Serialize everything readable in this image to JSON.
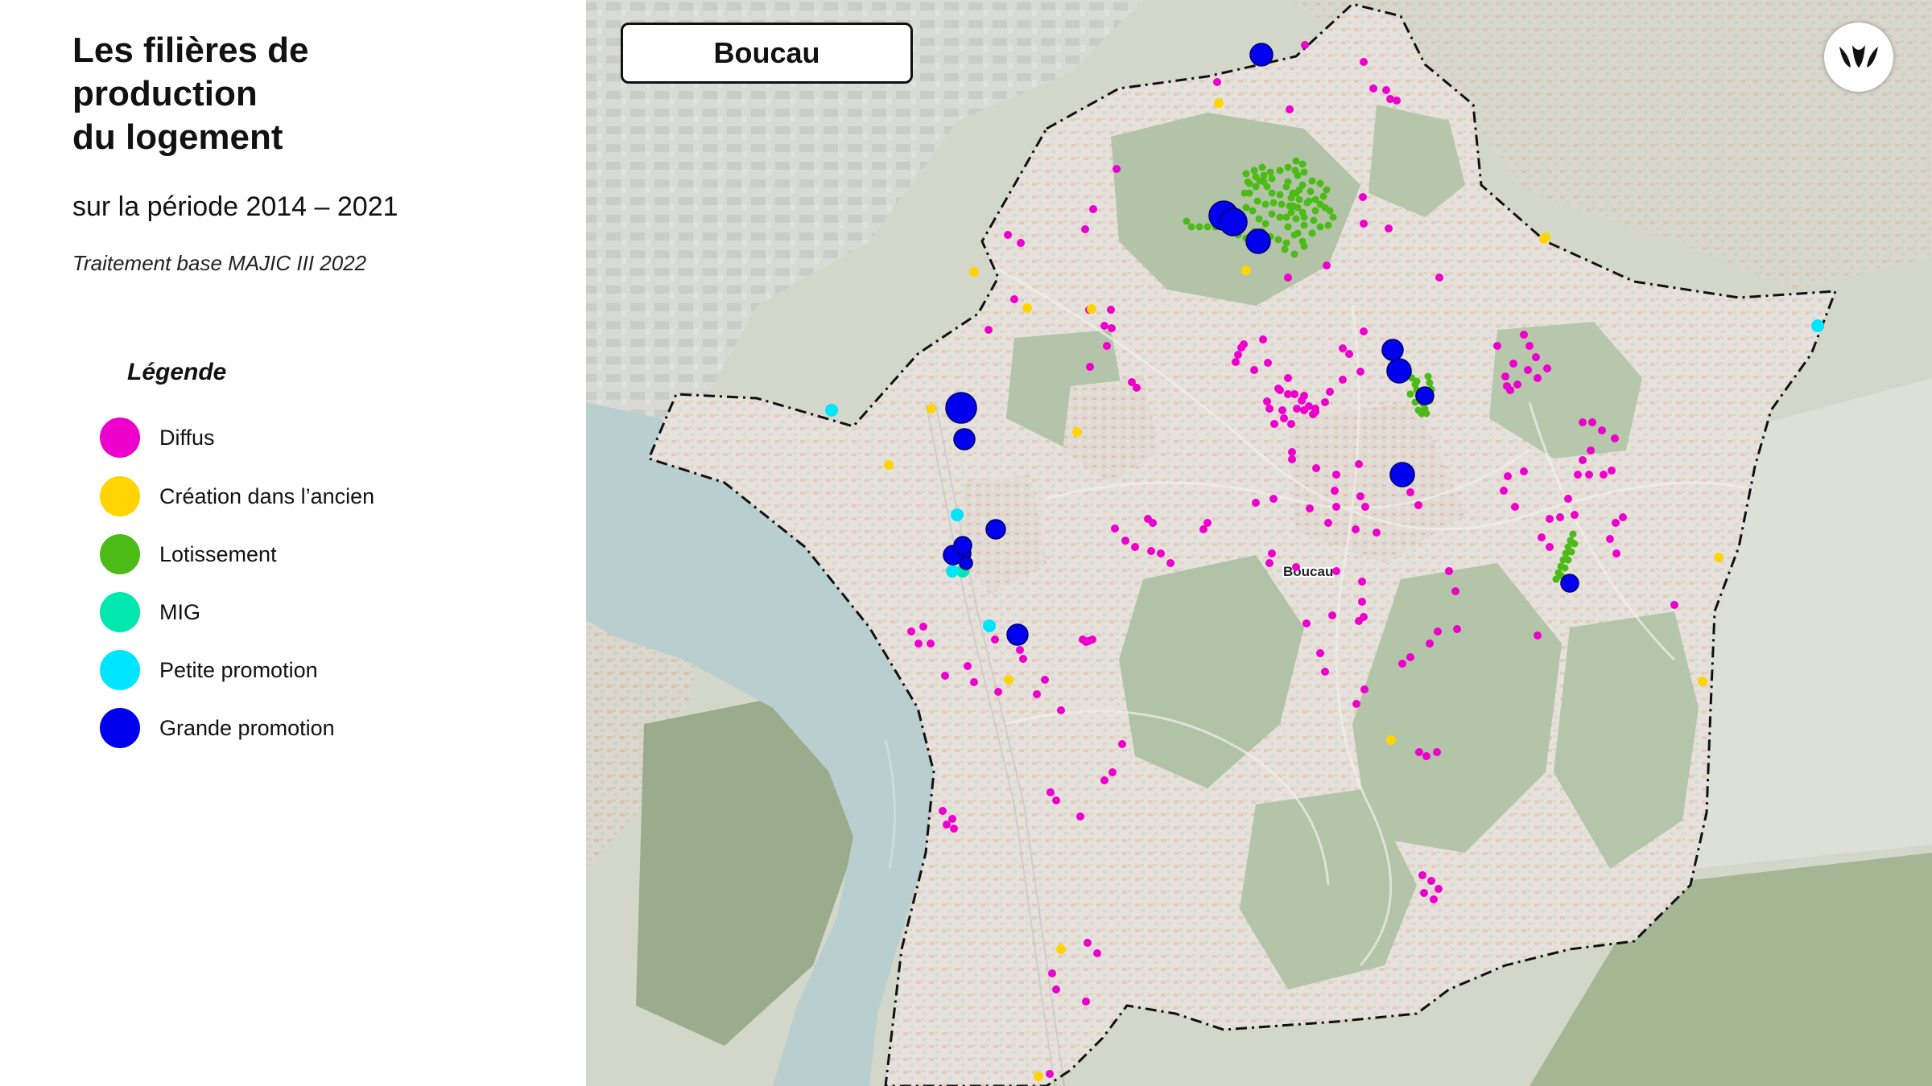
{
  "title_lines": [
    "Les filières de",
    "production",
    "du logement"
  ],
  "subtitle": "sur la période 2014 – 2021",
  "source": "Traitement base MAJIC III 2022",
  "commune": "Boucau",
  "map_label": "Boucau",
  "legend": {
    "title": "Légende",
    "items": [
      {
        "label": "Diffus",
        "color": "#ee00cc"
      },
      {
        "label": "Création dans l’ancien",
        "color": "#ffd400"
      },
      {
        "label": "Lotissement",
        "color": "#4cbb17"
      },
      {
        "label": "MIG",
        "color": "#00e8b0"
      },
      {
        "label": "Petite promotion",
        "color": "#00e5ff"
      },
      {
        "label": "Grande promotion",
        "color": "#0000ee"
      }
    ]
  },
  "logo_icon": "organization-logo"
}
